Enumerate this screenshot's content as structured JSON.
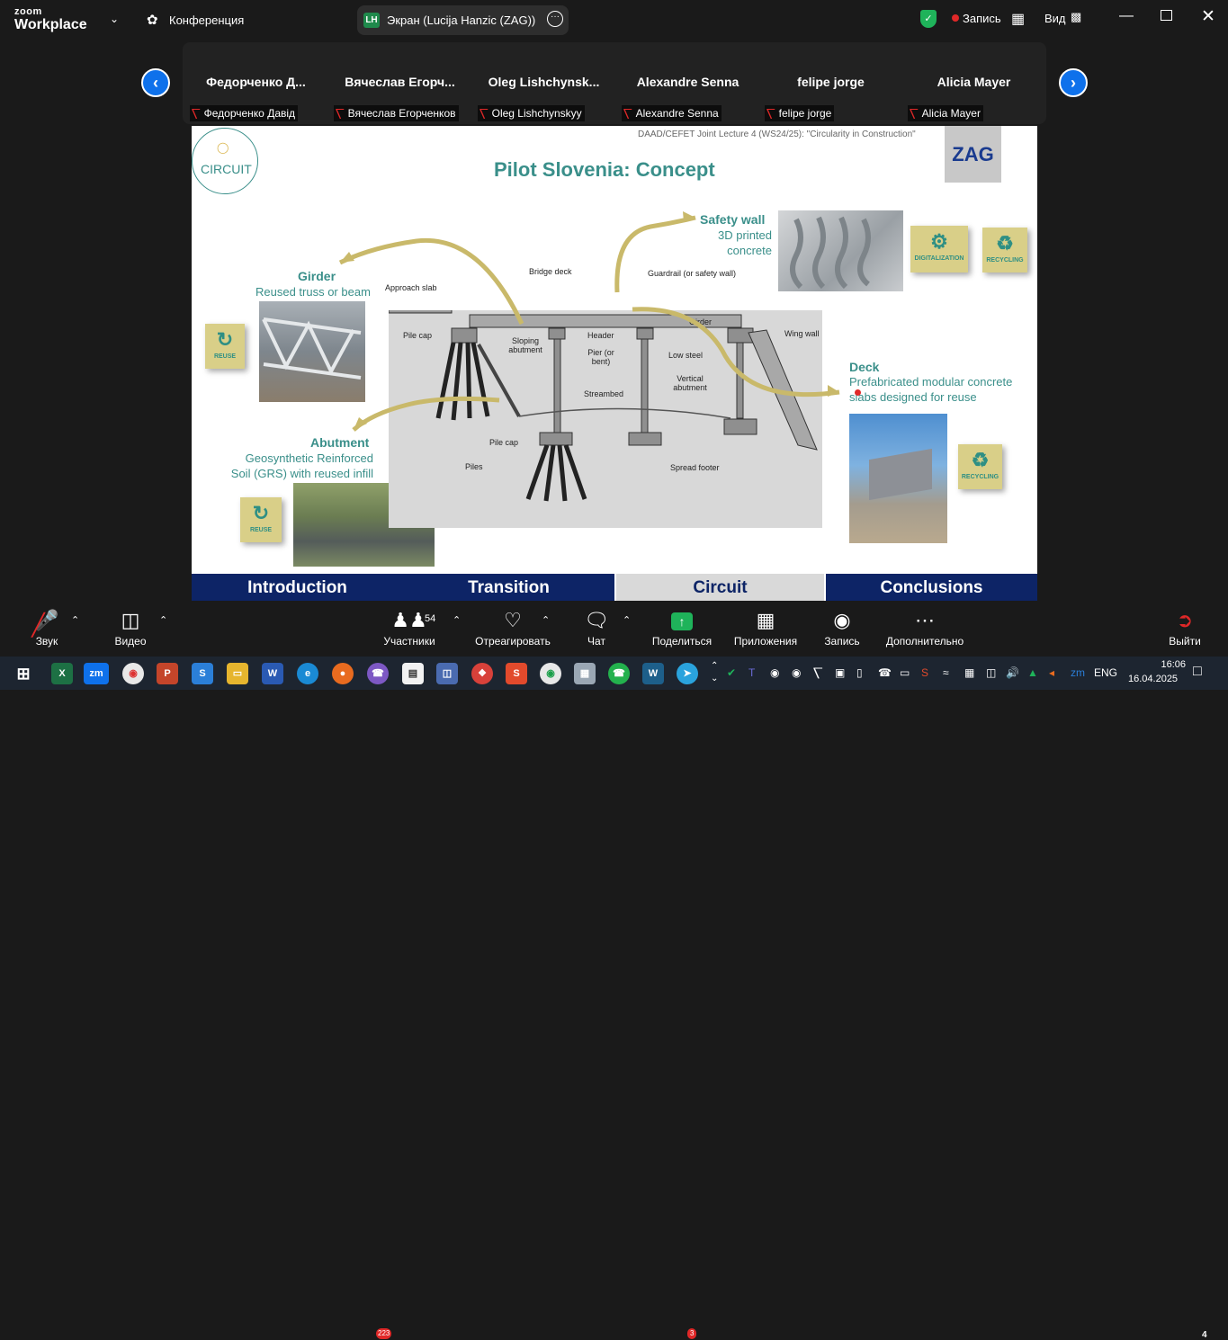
{
  "app": {
    "logo_top": "zoom",
    "logo_bottom": "Workplace",
    "conference_label": "Конференция",
    "share_initials": "LH",
    "share_title": "Экран (Lucija Hanzic (ZAG))",
    "record_label": "Запись",
    "view_label": "Вид"
  },
  "gallery": {
    "participants": [
      {
        "name": "Федорченко  Д...",
        "label": "Федорченко Давід"
      },
      {
        "name": "Вячеслав  Егорч...",
        "label": "Вячеслав Егорченков"
      },
      {
        "name": "Oleg  Lishchynsk...",
        "label": "Oleg Lishchynskyy"
      },
      {
        "name": "Alexandre Senna",
        "label": "Alexandre Senna"
      },
      {
        "name": "felipe jorge",
        "label": "felipe jorge"
      },
      {
        "name": "Alicia Mayer",
        "label": "Alicia Mayer"
      }
    ]
  },
  "slide": {
    "header_note": "DAAD/CEFET Joint Lecture 4 (WS24/25): \"Circularity in Construction\"",
    "logo_circuit": "CIRCUIT",
    "logo_zag": "ZAG",
    "title": "Pilot Slovenia: Concept",
    "safety_wall": {
      "title": "Safety wall",
      "line1": "3D printed",
      "line2": "concrete"
    },
    "girder": {
      "title": "Girder",
      "desc": "Reused truss or beam"
    },
    "abutment": {
      "title": "Abutment",
      "line1": "Geosynthetic Reinforced",
      "line2": "Soil (GRS) with reused infill"
    },
    "deck": {
      "title": "Deck",
      "line1": "Prefabricated modular concrete",
      "line2": "slabs designed for reuse"
    },
    "badges": {
      "digitalization": "DIGITALIZATION",
      "recycling": "RECYCLING",
      "reuse": "REUSE"
    },
    "bridge_labels": {
      "bridge_deck": "Bridge deck",
      "approach_slab": "Approach slab",
      "guardrail": "Guardrail (or safety wall)",
      "girder": "Girder",
      "pile_cap": "Pile cap",
      "sloping_abutment": "Sloping abutment",
      "header": "Header",
      "pier": "Pier (or bent)",
      "low_steel": "Low steel",
      "wing_wall": "Wing wall",
      "vertical_abutment": "Vertical abutment",
      "streambed": "Streambed",
      "pile_cap2": "Pile cap",
      "piles": "Piles",
      "spread_footer": "Spread footer"
    },
    "nav": [
      "Introduction",
      "Transition",
      "Circuit",
      "Conclusions"
    ],
    "nav_active": "Circuit"
  },
  "toolbar": {
    "audio": "Звук",
    "video": "Видео",
    "participants": "Участники",
    "participants_count": "54",
    "react": "Отреагировать",
    "chat": "Чат",
    "share": "Поделиться",
    "apps": "Приложения",
    "record": "Запись",
    "more": "Дополнительно",
    "leave": "Выйти"
  },
  "taskbar": {
    "viber_badge": "223",
    "telegram_badge": "3",
    "language": "ENG",
    "time": "16:06",
    "date": "16.04.2025",
    "notifications": "4"
  }
}
